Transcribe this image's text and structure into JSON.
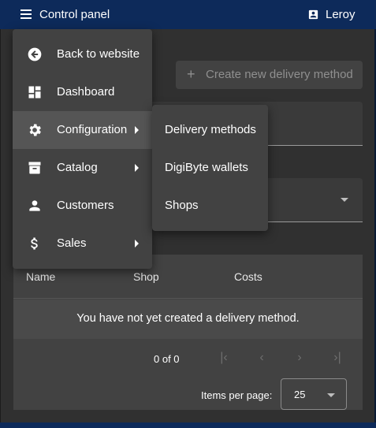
{
  "topbar": {
    "title": "Control panel",
    "user_name": "Leroy",
    "menu_icon": "menu-icon",
    "user_icon": "account-box-icon"
  },
  "toolbar": {
    "create_label": "Create new delivery method"
  },
  "table": {
    "columns": [
      "Name",
      "Shop",
      "Costs"
    ],
    "empty_message": "You have not yet created a delivery method."
  },
  "paginator": {
    "range_label": "0 of 0",
    "items_per_page_label": "Items per page:",
    "page_size": "25"
  },
  "menu": {
    "items": [
      {
        "label": "Back to website",
        "icon": "arrow-back-circle-icon"
      },
      {
        "label": "Dashboard",
        "icon": "dashboard-icon"
      },
      {
        "label": "Configuration",
        "icon": "gear-icon",
        "active": true,
        "has_submenu": true
      },
      {
        "label": "Catalog",
        "icon": "archive-icon",
        "has_submenu": true
      },
      {
        "label": "Customers",
        "icon": "person-icon"
      },
      {
        "label": "Sales",
        "icon": "dollar-icon",
        "has_submenu": true
      }
    ]
  },
  "submenu": {
    "items": [
      {
        "label": "Delivery methods"
      },
      {
        "label": "DigiByte wallets"
      },
      {
        "label": "Shops"
      }
    ]
  },
  "colors": {
    "topbar": "#0d2a5a",
    "content_bg": "#303030",
    "menu_bg": "#424242",
    "active_item": "#555555"
  }
}
